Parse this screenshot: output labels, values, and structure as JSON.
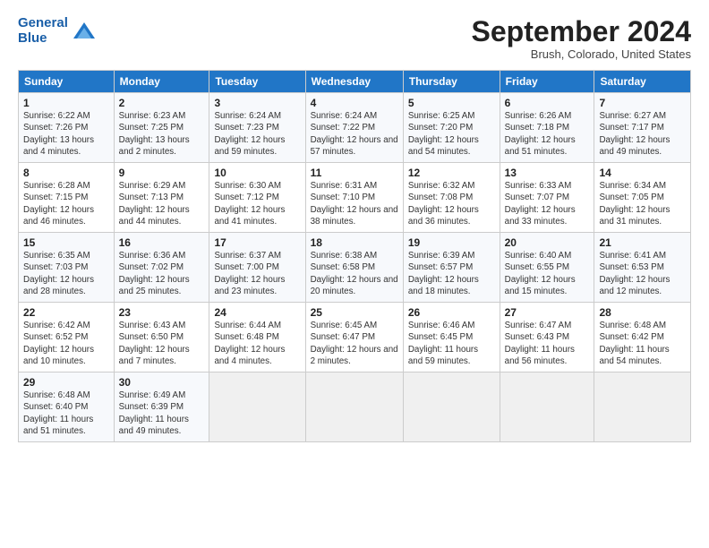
{
  "header": {
    "logo_line1": "General",
    "logo_line2": "Blue",
    "month_title": "September 2024",
    "subtitle": "Brush, Colorado, United States"
  },
  "days_of_week": [
    "Sunday",
    "Monday",
    "Tuesday",
    "Wednesday",
    "Thursday",
    "Friday",
    "Saturday"
  ],
  "weeks": [
    [
      {
        "day": "1",
        "sunrise": "Sunrise: 6:22 AM",
        "sunset": "Sunset: 7:26 PM",
        "daylight": "Daylight: 13 hours and 4 minutes."
      },
      {
        "day": "2",
        "sunrise": "Sunrise: 6:23 AM",
        "sunset": "Sunset: 7:25 PM",
        "daylight": "Daylight: 13 hours and 2 minutes."
      },
      {
        "day": "3",
        "sunrise": "Sunrise: 6:24 AM",
        "sunset": "Sunset: 7:23 PM",
        "daylight": "Daylight: 12 hours and 59 minutes."
      },
      {
        "day": "4",
        "sunrise": "Sunrise: 6:24 AM",
        "sunset": "Sunset: 7:22 PM",
        "daylight": "Daylight: 12 hours and 57 minutes."
      },
      {
        "day": "5",
        "sunrise": "Sunrise: 6:25 AM",
        "sunset": "Sunset: 7:20 PM",
        "daylight": "Daylight: 12 hours and 54 minutes."
      },
      {
        "day": "6",
        "sunrise": "Sunrise: 6:26 AM",
        "sunset": "Sunset: 7:18 PM",
        "daylight": "Daylight: 12 hours and 51 minutes."
      },
      {
        "day": "7",
        "sunrise": "Sunrise: 6:27 AM",
        "sunset": "Sunset: 7:17 PM",
        "daylight": "Daylight: 12 hours and 49 minutes."
      }
    ],
    [
      {
        "day": "8",
        "sunrise": "Sunrise: 6:28 AM",
        "sunset": "Sunset: 7:15 PM",
        "daylight": "Daylight: 12 hours and 46 minutes."
      },
      {
        "day": "9",
        "sunrise": "Sunrise: 6:29 AM",
        "sunset": "Sunset: 7:13 PM",
        "daylight": "Daylight: 12 hours and 44 minutes."
      },
      {
        "day": "10",
        "sunrise": "Sunrise: 6:30 AM",
        "sunset": "Sunset: 7:12 PM",
        "daylight": "Daylight: 12 hours and 41 minutes."
      },
      {
        "day": "11",
        "sunrise": "Sunrise: 6:31 AM",
        "sunset": "Sunset: 7:10 PM",
        "daylight": "Daylight: 12 hours and 38 minutes."
      },
      {
        "day": "12",
        "sunrise": "Sunrise: 6:32 AM",
        "sunset": "Sunset: 7:08 PM",
        "daylight": "Daylight: 12 hours and 36 minutes."
      },
      {
        "day": "13",
        "sunrise": "Sunrise: 6:33 AM",
        "sunset": "Sunset: 7:07 PM",
        "daylight": "Daylight: 12 hours and 33 minutes."
      },
      {
        "day": "14",
        "sunrise": "Sunrise: 6:34 AM",
        "sunset": "Sunset: 7:05 PM",
        "daylight": "Daylight: 12 hours and 31 minutes."
      }
    ],
    [
      {
        "day": "15",
        "sunrise": "Sunrise: 6:35 AM",
        "sunset": "Sunset: 7:03 PM",
        "daylight": "Daylight: 12 hours and 28 minutes."
      },
      {
        "day": "16",
        "sunrise": "Sunrise: 6:36 AM",
        "sunset": "Sunset: 7:02 PM",
        "daylight": "Daylight: 12 hours and 25 minutes."
      },
      {
        "day": "17",
        "sunrise": "Sunrise: 6:37 AM",
        "sunset": "Sunset: 7:00 PM",
        "daylight": "Daylight: 12 hours and 23 minutes."
      },
      {
        "day": "18",
        "sunrise": "Sunrise: 6:38 AM",
        "sunset": "Sunset: 6:58 PM",
        "daylight": "Daylight: 12 hours and 20 minutes."
      },
      {
        "day": "19",
        "sunrise": "Sunrise: 6:39 AM",
        "sunset": "Sunset: 6:57 PM",
        "daylight": "Daylight: 12 hours and 18 minutes."
      },
      {
        "day": "20",
        "sunrise": "Sunrise: 6:40 AM",
        "sunset": "Sunset: 6:55 PM",
        "daylight": "Daylight: 12 hours and 15 minutes."
      },
      {
        "day": "21",
        "sunrise": "Sunrise: 6:41 AM",
        "sunset": "Sunset: 6:53 PM",
        "daylight": "Daylight: 12 hours and 12 minutes."
      }
    ],
    [
      {
        "day": "22",
        "sunrise": "Sunrise: 6:42 AM",
        "sunset": "Sunset: 6:52 PM",
        "daylight": "Daylight: 12 hours and 10 minutes."
      },
      {
        "day": "23",
        "sunrise": "Sunrise: 6:43 AM",
        "sunset": "Sunset: 6:50 PM",
        "daylight": "Daylight: 12 hours and 7 minutes."
      },
      {
        "day": "24",
        "sunrise": "Sunrise: 6:44 AM",
        "sunset": "Sunset: 6:48 PM",
        "daylight": "Daylight: 12 hours and 4 minutes."
      },
      {
        "day": "25",
        "sunrise": "Sunrise: 6:45 AM",
        "sunset": "Sunset: 6:47 PM",
        "daylight": "Daylight: 12 hours and 2 minutes."
      },
      {
        "day": "26",
        "sunrise": "Sunrise: 6:46 AM",
        "sunset": "Sunset: 6:45 PM",
        "daylight": "Daylight: 11 hours and 59 minutes."
      },
      {
        "day": "27",
        "sunrise": "Sunrise: 6:47 AM",
        "sunset": "Sunset: 6:43 PM",
        "daylight": "Daylight: 11 hours and 56 minutes."
      },
      {
        "day": "28",
        "sunrise": "Sunrise: 6:48 AM",
        "sunset": "Sunset: 6:42 PM",
        "daylight": "Daylight: 11 hours and 54 minutes."
      }
    ],
    [
      {
        "day": "29",
        "sunrise": "Sunrise: 6:48 AM",
        "sunset": "Sunset: 6:40 PM",
        "daylight": "Daylight: 11 hours and 51 minutes."
      },
      {
        "day": "30",
        "sunrise": "Sunrise: 6:49 AM",
        "sunset": "Sunset: 6:39 PM",
        "daylight": "Daylight: 11 hours and 49 minutes."
      },
      null,
      null,
      null,
      null,
      null
    ]
  ]
}
